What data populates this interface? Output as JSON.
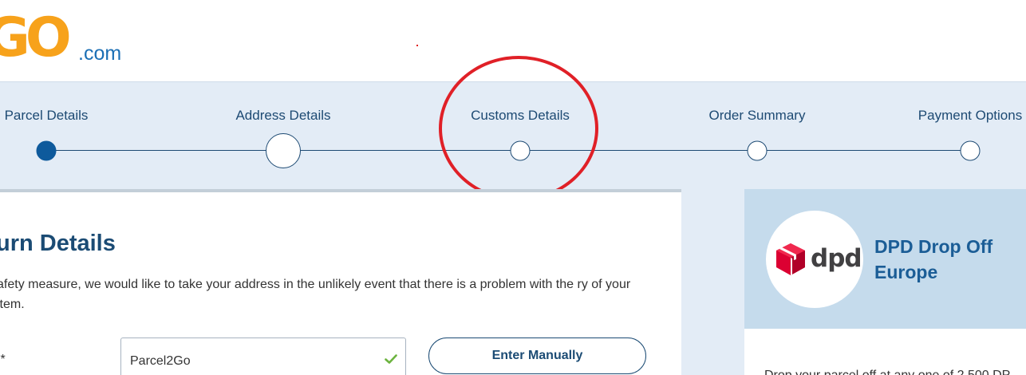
{
  "logo": {
    "main": "GO",
    "suffix": ".com"
  },
  "steps": [
    {
      "label": "Parcel Details",
      "state": "done"
    },
    {
      "label": "Address Details",
      "state": "current"
    },
    {
      "label": "Customs Details",
      "state": "upcoming"
    },
    {
      "label": "Order Summary",
      "state": "upcoming"
    },
    {
      "label": "Payment Options",
      "state": "upcoming"
    }
  ],
  "return_details": {
    "title": "urn Details",
    "description": "afety measure, we would like to take your address in the unlikely event that there is a problem with the ry of your item.",
    "field_label": ":*",
    "field_value": "Parcel2Go",
    "enter_manually": "Enter Manually"
  },
  "service": {
    "logo_text": "dpd",
    "name": "DPD Drop Off Europe",
    "description": "Drop your parcel off at any one of 2,500 DP"
  },
  "colors": {
    "brand_orange": "#f7a21b",
    "brand_blue": "#1b6fb5",
    "navy": "#1b4b74",
    "steps_bg": "#e3ecf6",
    "annotation_red": "#e02027",
    "dpd_red": "#dc0032",
    "valid_green": "#6cb33f"
  },
  "icons": {
    "check": "check-icon",
    "dpd": "dpd-cube-icon"
  }
}
